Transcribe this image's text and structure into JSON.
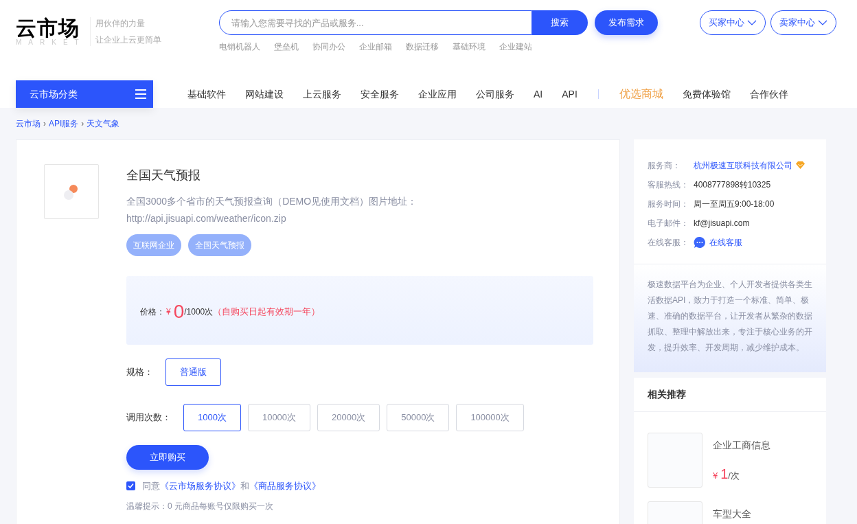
{
  "header": {
    "logo": {
      "title": "云市场",
      "subtitle": "MARKET"
    },
    "slogans": [
      "用伙伴的力量",
      "让企业上云更简单"
    ],
    "search": {
      "placeholder": "请输入您需要寻找的产品或服务...",
      "button": "搜索"
    },
    "hot_keywords": [
      "电销机器人",
      "堡垒机",
      "协同办公",
      "企业邮箱",
      "数据迁移",
      "基础环境",
      "企业建站"
    ],
    "publish_button": "发布需求",
    "center_menus": [
      "买家中心",
      "卖家中心"
    ]
  },
  "nav": {
    "category_button": "云市场分类",
    "items": [
      {
        "kind": "link",
        "label": "基础软件"
      },
      {
        "kind": "link",
        "label": "网站建设"
      },
      {
        "kind": "link",
        "label": "上云服务"
      },
      {
        "kind": "link",
        "label": "安全服务"
      },
      {
        "kind": "link",
        "label": "企业应用"
      },
      {
        "kind": "link",
        "label": "公司服务"
      },
      {
        "kind": "link",
        "label": "AI"
      },
      {
        "kind": "link",
        "label": "API"
      },
      {
        "kind": "separator"
      },
      {
        "kind": "featured",
        "label": "优选商城"
      },
      {
        "kind": "link",
        "label": "免费体验馆"
      },
      {
        "kind": "link",
        "label": "合作伙伴"
      }
    ]
  },
  "breadcrumb": {
    "separator": "›",
    "items": [
      "云市场",
      "API服务",
      "天文气象"
    ]
  },
  "product": {
    "title": "全国天气预报",
    "description": "全国3000多个省市的天气预报查询（DEMO见使用文档）图片地址：http://api.jisuapi.com/weather/icon.zip",
    "tags": [
      "互联网企业",
      "全国天气预报"
    ],
    "price": {
      "label": "价格：",
      "currency": "¥",
      "amount": "0",
      "unit": "/1000次",
      "note": "（自购买日起有效期一年）"
    },
    "spec": {
      "label": "规格：",
      "options": [
        {
          "label": "普通版",
          "selected": true
        }
      ]
    },
    "calls": {
      "label": "调用次数：",
      "options": [
        {
          "label": "1000次",
          "selected": true
        },
        {
          "label": "10000次",
          "selected": false
        },
        {
          "label": "20000次",
          "selected": false
        },
        {
          "label": "50000次",
          "selected": false
        },
        {
          "label": "100000次",
          "selected": false
        }
      ]
    },
    "buy_button": "立即购买",
    "agreement": {
      "checked": true,
      "prefix": "同意",
      "links": [
        "《云市场服务协议》",
        "《商品服务协议》"
      ],
      "joiner": "和"
    },
    "tip": "温馨提示：0 元商品每账号仅限购买一次"
  },
  "sidebar": {
    "provider": [
      {
        "kind": "company",
        "label": "服务商：",
        "value": "杭州极速互联科技有限公司"
      },
      {
        "kind": "text",
        "label": "客服热线：",
        "value": "4008777898转10325"
      },
      {
        "kind": "text",
        "label": "服务时间：",
        "value": "周一至周五9:00-18:00"
      },
      {
        "kind": "text",
        "label": "电子邮件：",
        "value": "kf@jisuapi.com"
      },
      {
        "kind": "chat",
        "label": "在线客服：",
        "value": "在线客服"
      }
    ],
    "about": "极速数据平台为企业、个人开发者提供各类生活数据API，致力于打造一个标准、简单、极速、准确的数据平台，让开发者从繁杂的数据抓取、整理中解放出来，专注于核心业务的开发，提升效率、开发周期，减少维护成本。",
    "related": {
      "title": "相关推荐",
      "items": [
        {
          "name": "企业工商信息",
          "currency": "¥",
          "price": "1",
          "unit": "/次"
        },
        {
          "name": "车型大全"
        }
      ]
    }
  }
}
